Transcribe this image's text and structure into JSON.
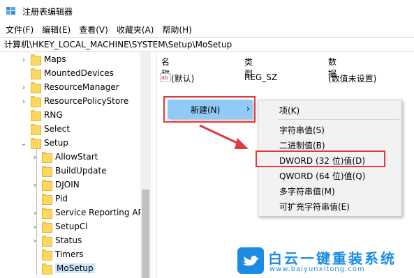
{
  "window": {
    "title": "注册表编辑器"
  },
  "menubar": [
    "文件(F)",
    "编辑(E)",
    "查看(V)",
    "收藏夹(A)",
    "帮助(H)"
  ],
  "address": "计算机\\HKEY_LOCAL_MACHINE\\SYSTEM\\Setup\\MoSetup",
  "tree": {
    "items": [
      {
        "label": "Maps",
        "level": 1,
        "expandable": true
      },
      {
        "label": "MountedDevices",
        "level": 1,
        "expandable": false
      },
      {
        "label": "ResourceManager",
        "level": 1,
        "expandable": true
      },
      {
        "label": "ResourcePolicyStore",
        "level": 1,
        "expandable": true
      },
      {
        "label": "RNG",
        "level": 1,
        "expandable": false
      },
      {
        "label": "Select",
        "level": 1,
        "expandable": false
      },
      {
        "label": "Setup",
        "level": 1,
        "expandable": true,
        "expanded": true
      },
      {
        "label": "AllowStart",
        "level": 2,
        "expandable": true
      },
      {
        "label": "BuildUpdate",
        "level": 2,
        "expandable": false
      },
      {
        "label": "DJOIN",
        "level": 2,
        "expandable": true
      },
      {
        "label": "Pid",
        "level": 2,
        "expandable": false
      },
      {
        "label": "Service Reporting AP",
        "level": 2,
        "expandable": true
      },
      {
        "label": "SetupCl",
        "level": 2,
        "expandable": true
      },
      {
        "label": "Status",
        "level": 2,
        "expandable": true
      },
      {
        "label": "Timers",
        "level": 2,
        "expandable": false
      },
      {
        "label": "MoSetup",
        "level": 2,
        "expandable": false,
        "selected": true
      }
    ]
  },
  "list": {
    "headers": {
      "name": "名称",
      "type": "类型",
      "data": "数据"
    },
    "rows": [
      {
        "name": "(默认)",
        "type": "REG_SZ",
        "data": "(数值未设置)"
      }
    ]
  },
  "context_menu": {
    "new_label": "新建(N)",
    "submenu": [
      "项(K)",
      "字符串值(S)",
      "二进制值(B)",
      "DWORD (32 位)值(D)",
      "QWORD (64 位)值(Q)",
      "多字符串值(M)",
      "可扩充字符串值(E)"
    ]
  },
  "watermark": {
    "brand": "白云一键重装系统",
    "url": "www.baiyunxitong.com"
  },
  "colors": {
    "highlight": "#91c9f7",
    "annotation_red": "#e0393e",
    "watermark_blue": "#1a8ce6"
  }
}
